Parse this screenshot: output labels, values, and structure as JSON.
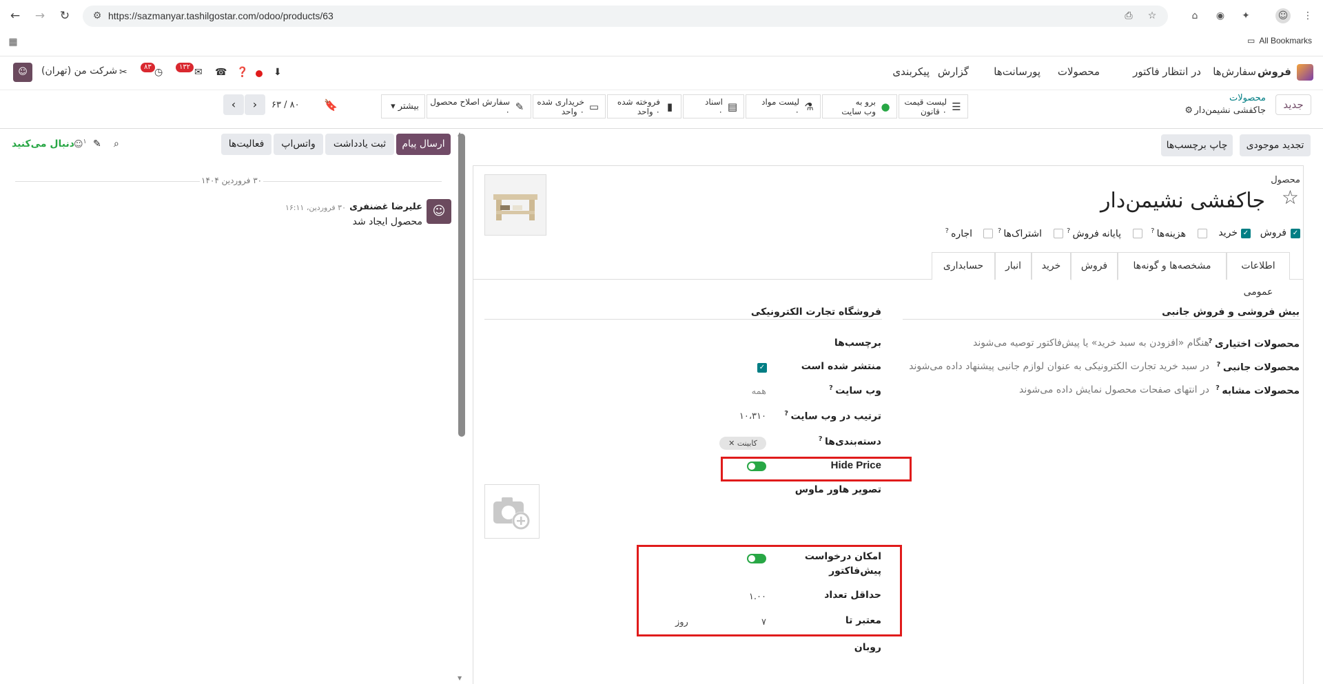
{
  "browser": {
    "url": "https://sazmanyar.tashilgostar.com/odoo/products/63",
    "bookmarks_label": "All Bookmarks"
  },
  "navbar": {
    "app_name": "فروش",
    "menus": [
      "سفارش‌ها",
      "در انتظار فاکتور",
      "محصولات",
      "پورسانت‌ها",
      "گزارش",
      "پیکربندی"
    ],
    "company": "شرکت من (تهران)",
    "activity_count": "۸۳",
    "message_count": "۱۳۲"
  },
  "control_panel": {
    "new_button": "جدید",
    "breadcrumb_parent": "محصولات",
    "breadcrumb_current": "جاکفشی نشیمن‌دار",
    "pager": "۶۳ / ۸۰",
    "more_label": "بیشتر",
    "smart_buttons": [
      {
        "line1": "لیست قیمت",
        "line2": "۰ قانون",
        "icon": "list-icon"
      },
      {
        "line1": "برو به",
        "line2": "وب سایت",
        "icon": "globe-icon"
      },
      {
        "line1": "لیست مواد",
        "line2": "۰",
        "icon": "flask-icon"
      },
      {
        "line1": "اسناد",
        "line2": "۰",
        "icon": "document-icon"
      },
      {
        "line1": "فروخته شده",
        "line2": "۰ واحد",
        "icon": "chart-icon"
      },
      {
        "line1": "خریداری شده",
        "line2": "۰ واحد",
        "icon": "card-icon"
      },
      {
        "line1": "سفارش اصلاح محصول",
        "line2": "۰",
        "icon": "wrench-icon"
      }
    ]
  },
  "form_actions": {
    "update_stock": "تجدید موجودی",
    "print_labels": "چاپ برچسب‌ها"
  },
  "chatter": {
    "send_message": "ارسال پیام",
    "log_note": "ثبت یادداشت",
    "whatsapp": "واتس‌اپ",
    "activities": "فعالیت‌ها",
    "follow": "دنبال می‌کنید",
    "followers_count": "۱",
    "date_separator": "۳۰ فروردین ۱۴۰۴",
    "author": "علیرضا غضنفری",
    "timestamp": "۳۰ فروردین، ۱۶:۱۱",
    "message": "محصول ایجاد شد"
  },
  "product": {
    "label": "محصول",
    "name": "جاکفشی نشیمن‌دار",
    "flags": [
      {
        "label": "فروش",
        "checked": true
      },
      {
        "label": "خرید",
        "checked": true
      },
      {
        "label": "هزینه‌ها",
        "checked": false
      },
      {
        "label": "پایانه فروش",
        "checked": false
      },
      {
        "label": "اشتراک‌ها",
        "checked": false
      },
      {
        "label": "اجاره",
        "checked": false
      }
    ]
  },
  "tabs": [
    "اطلاعات عمومی",
    "مشخصه‌ها و گونه‌ها",
    "فروش",
    "خرید",
    "انبار",
    "حسابداری"
  ],
  "active_tab": "فروش",
  "upsell": {
    "title": "بیش فروشی و فروش جانبی",
    "optional_label": "محصولات اختیاری",
    "optional_desc": "هنگام «افزودن به سبد خرید» یا پیش‌فاکتور توصیه می‌شوند",
    "accessory_label": "محصولات جانبی",
    "accessory_desc": "در سبد خرید تجارت الکترونیکی به عنوان لوازم جانبی پیشنهاد داده می‌شوند",
    "alternative_label": "محصولات مشابه",
    "alternative_desc": "در انتهای صفحات محصول نمایش داده می‌شوند"
  },
  "ecommerce": {
    "title": "فروشگاه تجارت الکترونیکی",
    "tags_label": "برچسب‌ها",
    "published_label": "منتشر شده است",
    "published": true,
    "website_label": "وب سایت",
    "website_value": "همه",
    "sequence_label": "ترتیب در وب سایت",
    "sequence_value": "۱۰،۳۱۰",
    "categories_label": "دسته‌بندی‌ها",
    "category_tag": "کابینت",
    "hide_price_label": "Hide Price",
    "hide_price": true,
    "hover_image_label": "تصویر هاور ماوس",
    "quotation_label_1": "امکان درخواست",
    "quotation_label_2": "پیش‌فاکتور",
    "quotation_enabled": true,
    "min_qty_label": "حداقل تعداد",
    "min_qty_value": "۱.۰۰",
    "valid_until_label": "معتبر تا",
    "valid_until_value": "۷",
    "valid_until_unit": "روز",
    "ribbon_label": "روبان"
  },
  "colors": {
    "brand": "#714b67",
    "accent": "#017e84",
    "highlight_box": "#e01b1b"
  }
}
